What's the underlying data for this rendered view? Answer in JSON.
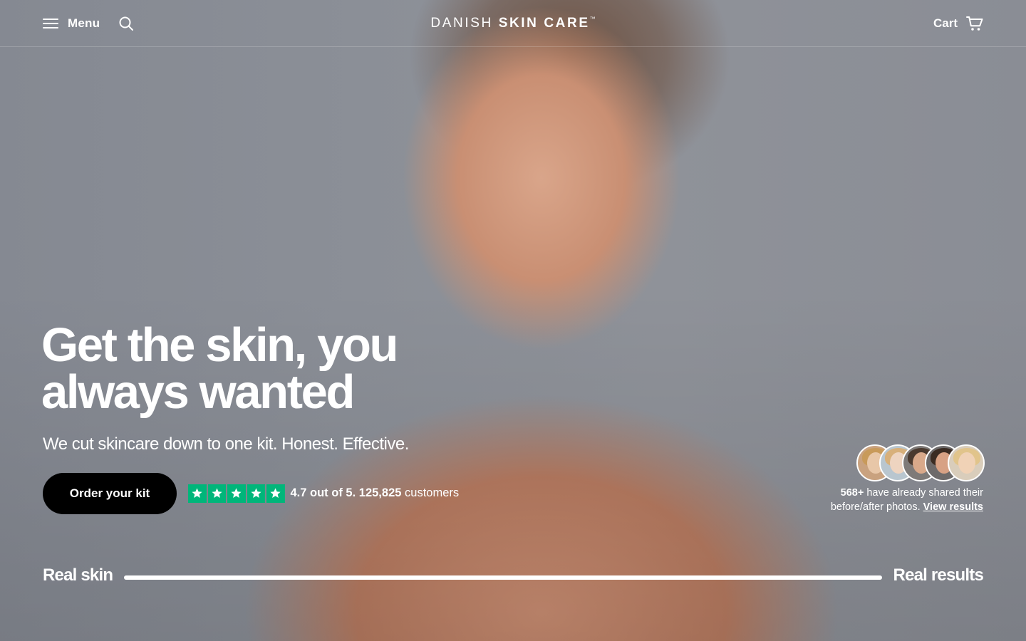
{
  "header": {
    "menu_label": "Menu",
    "logo_light": "DANISH ",
    "logo_strong": "SKIN CARE",
    "logo_mark": "™",
    "cart_label": "Cart"
  },
  "hero": {
    "title": "Get the skin, you always wanted",
    "subtitle": "We cut skincare down to one kit. Honest. Effective.",
    "cta_label": "Order your kit"
  },
  "rating": {
    "stars": 5,
    "star_color": "#00b67a",
    "score_text": "4.7 out of 5.",
    "count": "125,825",
    "count_label": "customers"
  },
  "social_proof": {
    "count": "568+",
    "text_1": "have already shared their",
    "text_2": "before/after photos.",
    "link_label": "View results",
    "avatars": 5
  },
  "compare": {
    "left_label": "Real skin",
    "right_label": "Real results",
    "fill_fraction": 1.0
  },
  "icons": {
    "menu": "hamburger-icon",
    "search": "search-icon",
    "cart": "cart-icon",
    "star": "star-icon"
  },
  "colors": {
    "cta_bg": "#000000",
    "text": "#ffffff",
    "trustpilot_green": "#00b67a"
  }
}
